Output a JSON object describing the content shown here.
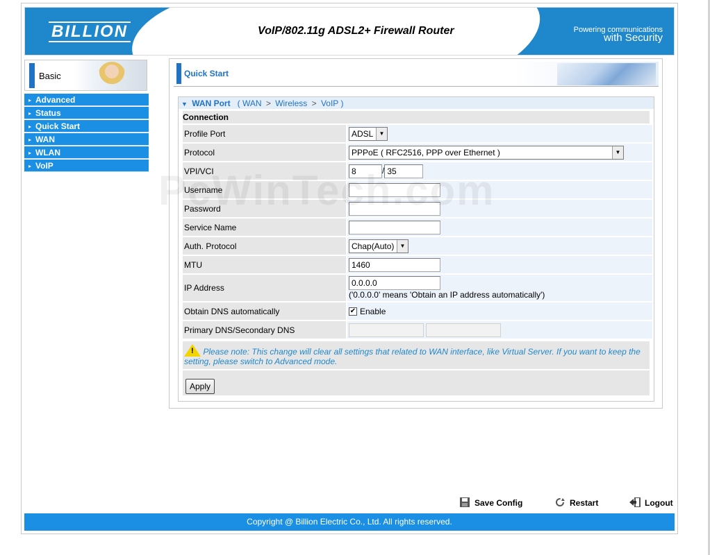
{
  "header": {
    "logo": "BILLION",
    "title": "VoIP/802.11g ADSL2+ Firewall Router",
    "tagline_line1": "Powering communications",
    "tagline_line2": "with Security"
  },
  "sidebar": {
    "basic_label": "Basic",
    "items": [
      {
        "label": "Advanced"
      },
      {
        "label": "Status"
      },
      {
        "label": "Quick Start"
      },
      {
        "label": "WAN"
      },
      {
        "label": "WLAN"
      },
      {
        "label": "VoIP"
      }
    ]
  },
  "page": {
    "title": "Quick Start",
    "breadcrumb": {
      "current": "WAN Port",
      "open": "(",
      "step1": "WAN",
      "step2": "Wireless",
      "step3": "VoIP",
      "close": ")",
      "sep": ">"
    },
    "section": "Connection"
  },
  "form": {
    "profile_port": {
      "label": "Profile Port",
      "value": "ADSL"
    },
    "protocol": {
      "label": "Protocol",
      "value": "PPPoE ( RFC2516, PPP over Ethernet )"
    },
    "vpi_vci": {
      "label": "VPI/VCI",
      "vpi": "8",
      "sep": "/",
      "vci": "35"
    },
    "username": {
      "label": "Username",
      "value": ""
    },
    "password": {
      "label": "Password",
      "value": ""
    },
    "service_name": {
      "label": "Service Name",
      "value": ""
    },
    "auth_protocol": {
      "label": "Auth. Protocol",
      "value": "Chap(Auto)"
    },
    "mtu": {
      "label": "MTU",
      "value": "1460"
    },
    "ip_address": {
      "label": "IP Address",
      "value": "0.0.0.0",
      "hint": "('0.0.0.0' means 'Obtain an IP address automatically')"
    },
    "obtain_dns": {
      "label": "Obtain DNS automatically",
      "checkbox_label": "Enable",
      "checked": true
    },
    "dns": {
      "label": "Primary DNS/Secondary DNS",
      "primary": "",
      "secondary": ""
    }
  },
  "note": "Please note: This change will clear all settings that related to WAN interface, like Virtual Server. If you want to keep the setting, please switch to Advanced mode.",
  "apply_label": "Apply",
  "footer": {
    "save_config": "Save Config",
    "restart": "Restart",
    "logout": "Logout",
    "copyright": "Copyright @ Billion Electric Co., Ltd. All rights reserved."
  },
  "watermark": "PcWinTech.com",
  "colors": {
    "accent": "#1a8fe3",
    "link": "#1f72c4"
  }
}
